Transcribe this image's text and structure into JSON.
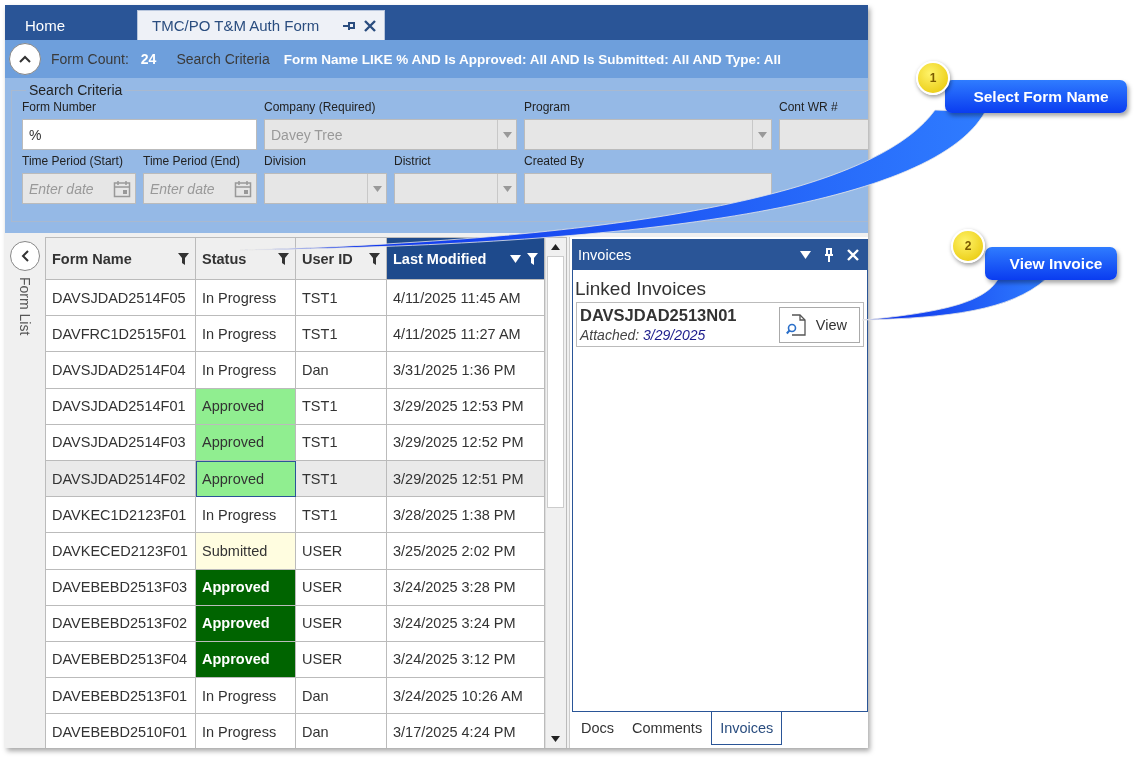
{
  "tabs": [
    {
      "label": "Home",
      "selected": false,
      "closable": false
    },
    {
      "label": "TMC/PO T&M Auth Form",
      "selected": true,
      "closable": true
    }
  ],
  "summary": {
    "count_label": "Form Count:",
    "count": "24",
    "criteria_label": "Search Criteria",
    "criteria": "Form Name LIKE % AND Is Approved: All AND Is Submitted: All AND Type: All"
  },
  "search_criteria": {
    "title": "Search Criteria",
    "fields": [
      {
        "label": "Form Number",
        "kind": "text",
        "value": "%",
        "disabled": false
      },
      {
        "label": "Company (Required)",
        "kind": "combo",
        "value": "Davey Tree",
        "disabled": true
      },
      {
        "label": "Program",
        "kind": "combo",
        "disabled": true
      },
      {
        "label": "Cont WR #",
        "kind": "text",
        "disabled": true
      },
      {
        "label": "Time Period (Start)",
        "kind": "date",
        "placeholder": "Enter date",
        "disabled": true
      },
      {
        "label": "Time Period (End)",
        "kind": "date",
        "placeholder": "Enter date",
        "disabled": true
      },
      {
        "label": "Division",
        "kind": "combo",
        "disabled": true
      },
      {
        "label": "District",
        "kind": "combo",
        "disabled": true
      },
      {
        "label": "Created By",
        "kind": "text",
        "disabled": true
      }
    ]
  },
  "form_list": {
    "label": "Form List",
    "columns": [
      {
        "label": "Form Name",
        "sorted": false
      },
      {
        "label": "Status",
        "sorted": false
      },
      {
        "label": "User ID",
        "sorted": false
      },
      {
        "label": "Last Modified",
        "sorted": true
      }
    ],
    "rows": [
      {
        "form_name": "DAVSJDAD2514F05",
        "status": "In Progress",
        "color": "#ffffff",
        "user_id": "TST1",
        "last_modified": "4/11/2025 11:45 AM",
        "selected": false
      },
      {
        "form_name": "DAVFRC1D2515F01",
        "status": "In Progress",
        "color": "#ffffff",
        "user_id": "TST1",
        "last_modified": "4/11/2025 11:27 AM",
        "selected": false
      },
      {
        "form_name": "DAVSJDAD2514F04",
        "status": "In Progress",
        "color": "#ffffff",
        "user_id": "Dan",
        "last_modified": "3/31/2025 1:36 PM",
        "selected": false
      },
      {
        "form_name": "DAVSJDAD2514F01",
        "status": "Approved",
        "color": "#90ee90",
        "user_id": "TST1",
        "last_modified": "3/29/2025 12:53 PM",
        "selected": false
      },
      {
        "form_name": "DAVSJDAD2514F03",
        "status": "Approved",
        "color": "#90ee90",
        "user_id": "TST1",
        "last_modified": "3/29/2025 12:52 PM",
        "selected": false
      },
      {
        "form_name": "DAVSJDAD2514F02",
        "status": "Approved",
        "color": "#90ee90",
        "user_id": "TST1",
        "last_modified": "3/29/2025 12:51 PM",
        "selected": true
      },
      {
        "form_name": "DAVKEC1D2123F01",
        "status": "In Progress",
        "color": "#ffffff",
        "user_id": "TST1",
        "last_modified": "3/28/2025 1:38 PM",
        "selected": false
      },
      {
        "form_name": "DAVKECED2123F01",
        "status": "Submitted",
        "color": "#fffde0",
        "user_id": "USER",
        "last_modified": "3/25/2025 2:02 PM",
        "selected": false
      },
      {
        "form_name": "DAVEBEBD2513F03",
        "status": "Approved",
        "color": "#006400",
        "user_id": "USER",
        "last_modified": "3/24/2025 3:28 PM",
        "selected": false
      },
      {
        "form_name": "DAVEBEBD2513F02",
        "status": "Approved",
        "color": "#006400",
        "user_id": "USER",
        "last_modified": "3/24/2025 3:24 PM",
        "selected": false
      },
      {
        "form_name": "DAVEBEBD2513F04",
        "status": "Approved",
        "color": "#006400",
        "user_id": "USER",
        "last_modified": "3/24/2025 3:12 PM",
        "selected": false
      },
      {
        "form_name": "DAVEBEBD2513F01",
        "status": "In Progress",
        "color": "#ffffff",
        "user_id": "Dan",
        "last_modified": "3/24/2025 10:26 AM",
        "selected": false
      },
      {
        "form_name": "DAVEBEBD2510F01",
        "status": "In Progress",
        "color": "#ffffff",
        "user_id": "Dan",
        "last_modified": "3/17/2025 4:24 PM",
        "selected": false
      }
    ]
  },
  "invoices_panel": {
    "title": "Invoices",
    "heading": "Linked Invoices",
    "invoices": [
      {
        "number": "DAVSJDAD2513N01",
        "attached_label": "Attached:",
        "attached_date": "3/29/2025",
        "button": "View"
      }
    ],
    "tabs": [
      {
        "label": "Docs",
        "selected": false
      },
      {
        "label": "Comments",
        "selected": false
      },
      {
        "label": "Invoices",
        "selected": true
      }
    ]
  },
  "callouts": [
    {
      "number": "1",
      "text": "Select Form Name"
    },
    {
      "number": "2",
      "text": "View Invoice"
    }
  ]
}
